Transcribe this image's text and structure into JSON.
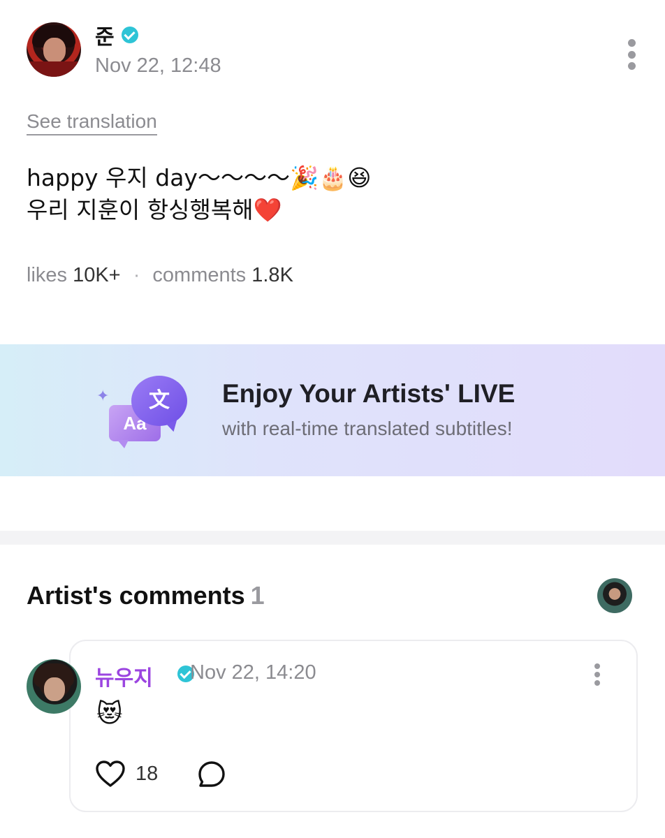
{
  "post": {
    "author": "준",
    "date": "Nov 22, 12:48",
    "see_translation": "See translation",
    "body_line1": "happy 우지 day～～～～🎉🎂😆",
    "body_line2": "우리 지훈이 항싱행복해❤️",
    "likes_label": "likes",
    "likes_value": "10K+",
    "separator": "·",
    "comments_label": "comments",
    "comments_value": "1.8K"
  },
  "banner": {
    "title": "Enjoy Your Artists' LIVE",
    "subtitle": "with real-time translated subtitles!",
    "icon_text_aa": "Aa",
    "icon_text_wen": "文",
    "icon_sparkle": "✦"
  },
  "artist_comments": {
    "title": "Artist's comments",
    "count": "1"
  },
  "comment": {
    "author": "뉴우지",
    "date": "Nov 22, 14:20",
    "body": "😻",
    "like_count": "18"
  },
  "colors": {
    "verified": "#2ec4d6",
    "comment_author": "#9b45e0",
    "secondary_text": "#8b8b90",
    "banner_accent": "#7a5bea"
  },
  "icons": {
    "post_menu": "more-vertical-icon",
    "verified": "verified-badge-icon",
    "like": "heart-outline-icon",
    "reply": "speech-bubble-icon"
  }
}
